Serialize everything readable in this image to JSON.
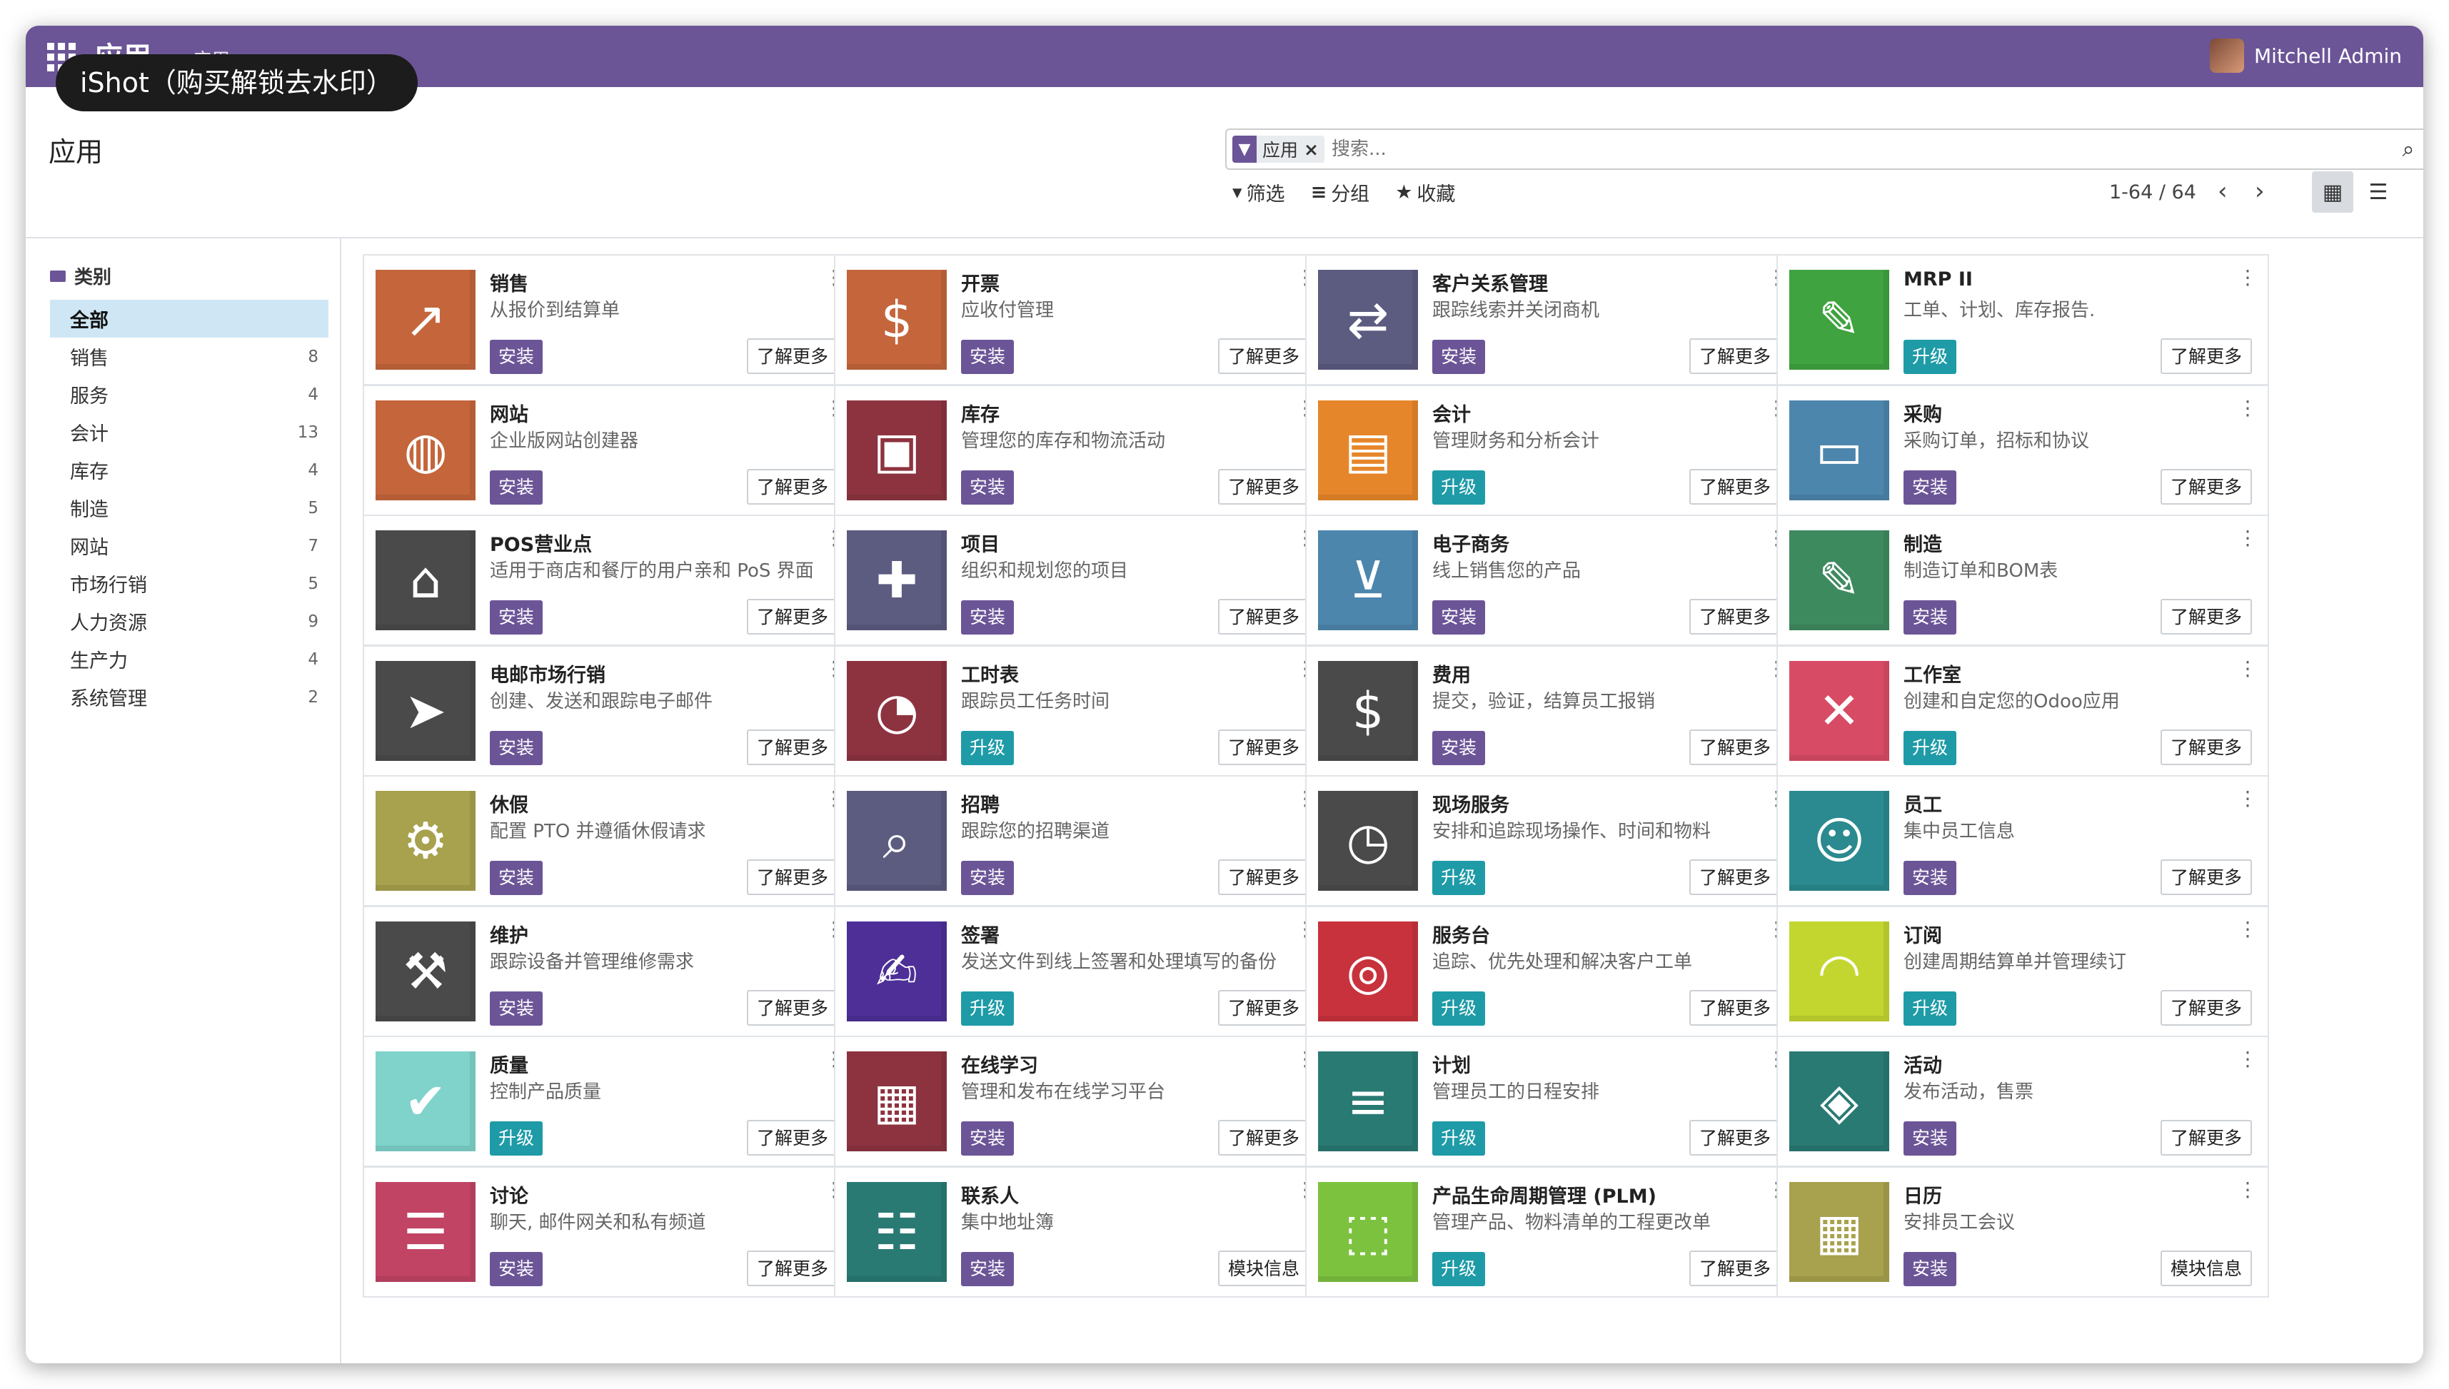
{
  "navbar": {
    "title": "应用",
    "subtitle": "应用",
    "user": "Mitchell Admin"
  },
  "watermark": "iShot（购买解锁去水印）",
  "page_title": "应用",
  "search": {
    "facet_label": "应用",
    "placeholder": "搜索..."
  },
  "toolbar": {
    "filter": "筛选",
    "group": "分组",
    "favorite": "收藏"
  },
  "pager": {
    "range": "1-64 / 64"
  },
  "sidebar": {
    "header": "类别",
    "categories": [
      {
        "label": "全部",
        "count": ""
      },
      {
        "label": "销售",
        "count": "8"
      },
      {
        "label": "服务",
        "count": "4"
      },
      {
        "label": "会计",
        "count": "13"
      },
      {
        "label": "库存",
        "count": "4"
      },
      {
        "label": "制造",
        "count": "5"
      },
      {
        "label": "网站",
        "count": "7"
      },
      {
        "label": "市场行销",
        "count": "5"
      },
      {
        "label": "人力资源",
        "count": "9"
      },
      {
        "label": "生产力",
        "count": "4"
      },
      {
        "label": "系统管理",
        "count": "2"
      }
    ]
  },
  "colors": {
    "brand": "#6b5597",
    "upgrade": "#1e9ba7",
    "active_category": "#cfe7f5"
  },
  "apps": [
    {
      "name": "销售",
      "desc": "从报价到结算单",
      "action": "安装",
      "more": "了解更多",
      "icon": "chart-up-icon",
      "color": "#c4653b"
    },
    {
      "name": "开票",
      "desc": "应收付管理",
      "action": "安装",
      "more": "了解更多",
      "icon": "invoice-dollar-icon",
      "color": "#c4653b"
    },
    {
      "name": "客户关系管理",
      "desc": "跟踪线索并关闭商机",
      "action": "安装",
      "more": "了解更多",
      "icon": "handshake-icon",
      "color": "#5c5b80"
    },
    {
      "name": "MRP II",
      "desc": "工单、计划、库存报告.",
      "action": "升级",
      "more": "了解更多",
      "icon": "wrench-icon",
      "color": "#3fa33f"
    },
    {
      "name": "网站",
      "desc": "企业版网站创建器",
      "action": "安装",
      "more": "了解更多",
      "icon": "globe-icon",
      "color": "#c4653b"
    },
    {
      "name": "库存",
      "desc": "管理您的库存和物流活动",
      "action": "安装",
      "more": "了解更多",
      "icon": "box-open-icon",
      "color": "#8d3340"
    },
    {
      "name": "会计",
      "desc": "管理财务和分析会计",
      "action": "升级",
      "more": "了解更多",
      "icon": "document-icon",
      "color": "#e6862a"
    },
    {
      "name": "采购",
      "desc": "采购订单，招标和协议",
      "action": "安装",
      "more": "了解更多",
      "icon": "credit-card-icon",
      "color": "#4d86ad"
    },
    {
      "name": "POS营业点",
      "desc": "适用于商店和餐厅的用户亲和 PoS 界面",
      "action": "安装",
      "more": "了解更多",
      "icon": "store-icon",
      "color": "#4a4a4a"
    },
    {
      "name": "项目",
      "desc": "组织和规划您的项目",
      "action": "安装",
      "more": "了解更多",
      "icon": "puzzle-icon",
      "color": "#5c5b80"
    },
    {
      "name": "电子商务",
      "desc": "线上销售您的产品",
      "action": "安装",
      "more": "了解更多",
      "icon": "shopping-cart-icon",
      "color": "#4d86ad"
    },
    {
      "name": "制造",
      "desc": "制造订单和BOM表",
      "action": "安装",
      "more": "了解更多",
      "icon": "wrench-icon",
      "color": "#3e8a5f"
    },
    {
      "name": "电邮市场行销",
      "desc": "创建、发送和跟踪电子邮件",
      "action": "安装",
      "more": "了解更多",
      "icon": "paper-plane-icon",
      "color": "#4a4a4a"
    },
    {
      "name": "工时表",
      "desc": "跟踪员工任务时间",
      "action": "升级",
      "more": "了解更多",
      "icon": "stopwatch-icon",
      "color": "#8d3340"
    },
    {
      "name": "费用",
      "desc": "提交，验证，结算员工报销",
      "action": "安装",
      "more": "了解更多",
      "icon": "user-dollar-icon",
      "color": "#4a4a4a"
    },
    {
      "name": "工作室",
      "desc": "创建和自定您的Odoo应用",
      "action": "升级",
      "more": "了解更多",
      "icon": "tools-icon",
      "color": "#d84b65"
    },
    {
      "name": "休假",
      "desc": "配置 PTO 并遵循休假请求",
      "action": "安装",
      "more": "了解更多",
      "icon": "user-gear-icon",
      "color": "#a8a14d"
    },
    {
      "name": "招聘",
      "desc": "跟踪您的招聘渠道",
      "action": "安装",
      "more": "了解更多",
      "icon": "magnifier-icon",
      "color": "#5c5b80"
    },
    {
      "name": "现场服务",
      "desc": "安排和追踪现场操作、时间和物料",
      "action": "升级",
      "more": "了解更多",
      "icon": "puzzle-clock-icon",
      "color": "#4a4a4a"
    },
    {
      "name": "员工",
      "desc": "集中员工信息",
      "action": "安装",
      "more": "了解更多",
      "icon": "users-icon",
      "color": "#2a8a8f"
    },
    {
      "name": "维护",
      "desc": "跟踪设备并管理维修需求",
      "action": "安装",
      "more": "了解更多",
      "icon": "hammer-icon",
      "color": "#4a4a4a"
    },
    {
      "name": "签署",
      "desc": "发送文件到线上签署和处理填写的备份",
      "action": "升级",
      "more": "了解更多",
      "icon": "sign-document-icon",
      "color": "#4d2f97"
    },
    {
      "name": "服务台",
      "desc": "追踪、优先处理和解决客户工单",
      "action": "升级",
      "more": "了解更多",
      "icon": "life-ring-icon",
      "color": "#c8323c"
    },
    {
      "name": "订阅",
      "desc": "创建周期结算单并管理续订",
      "action": "升级",
      "more": "了解更多",
      "icon": "rss-icon",
      "color": "#c3d62f"
    },
    {
      "name": "质量",
      "desc": "控制产品质量",
      "action": "升级",
      "more": "了解更多",
      "icon": "quality-check-icon",
      "color": "#7fd3cb"
    },
    {
      "name": "在线学习",
      "desc": "管理和发布在线学习平台",
      "action": "安装",
      "more": "了解更多",
      "icon": "presentation-icon",
      "color": "#8d3340"
    },
    {
      "name": "计划",
      "desc": "管理员工的日程安排",
      "action": "升级",
      "more": "了解更多",
      "icon": "schedule-icon",
      "color": "#2a7a74"
    },
    {
      "name": "活动",
      "desc": "发布活动，售票",
      "action": "安装",
      "more": "了解更多",
      "icon": "ticket-icon",
      "color": "#2a7a74"
    },
    {
      "name": "讨论",
      "desc": "聊天, 邮件网关和私有频道",
      "action": "安装",
      "more": "了解更多",
      "icon": "chat-bubble-icon",
      "color": "#c14465"
    },
    {
      "name": "联系人",
      "desc": "集中地址簿",
      "action": "安装",
      "more": "模块信息",
      "icon": "address-book-icon",
      "color": "#2a7a74"
    },
    {
      "name": "产品生命周期管理 (PLM)",
      "desc": "管理产品、物料清单的工程更改单",
      "action": "升级",
      "more": "了解更多",
      "icon": "cube-icon",
      "color": "#7cc23f"
    },
    {
      "name": "日历",
      "desc": "安排员工会议",
      "action": "安装",
      "more": "模块信息",
      "icon": "calendar-icon",
      "color": "#a8a14d"
    }
  ]
}
